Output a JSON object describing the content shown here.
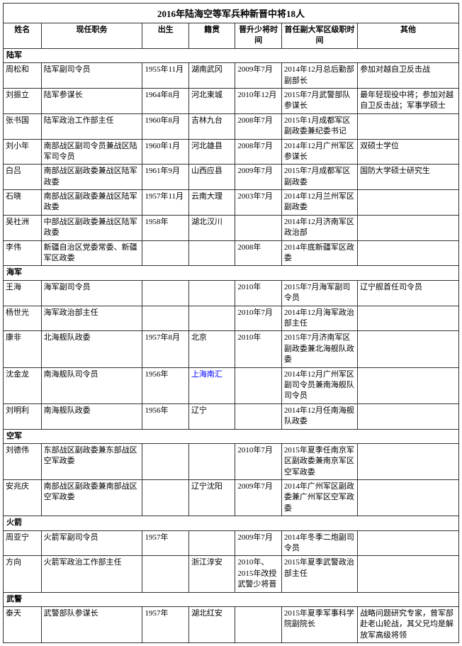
{
  "title": "2016年陆海空等军兵种新晋中将18人",
  "headers": [
    "姓名",
    "现任职务",
    "出生",
    "籍贯",
    "晋升少将时间",
    "首任副大军区级职时间",
    "其他"
  ],
  "sections": [
    {
      "section_name": "陆军",
      "rows": [
        {
          "name": "周松和",
          "job": "陆军副司令员",
          "birth": "1955年11月",
          "origin": "湖南武冈",
          "promote": "2009年7月",
          "vice": "2014年12月总后勤部副部长",
          "other": "参加对越自卫反击战"
        },
        {
          "name": "刘振立",
          "job": "陆军参谋长",
          "birth": "1964年8月",
          "origin": "河北束城",
          "promote": "2010年12月",
          "vice": "2015年7月武警部队参谋长",
          "other": "最年轻现役中将；参加对越自卫反击战；军事学硕士"
        },
        {
          "name": "张书国",
          "job": "陆军政治工作部主任",
          "birth": "1960年8月",
          "origin": "吉林九台",
          "promote": "2008年7月",
          "vice": "2015年1月成都军区副政委兼纪委书记",
          "other": ""
        },
        {
          "name": "刘小年",
          "job": "南部战区副司令员兼战区陆军司令员",
          "birth": "1960年1月",
          "origin": "河北雄县",
          "promote": "2008年7月",
          "vice": "2014年12月广州军区参谋长",
          "other": "双硕士学位"
        },
        {
          "name": "白吕",
          "job": "南部战区副政委兼战区陆军政委",
          "birth": "1961年9月",
          "origin": "山西应县",
          "promote": "2009年7月",
          "vice": "2015年7月成都军区副政委",
          "other": "国防大学硕士研究生"
        },
        {
          "name": "石晓",
          "job": "南部战区副政委兼战区陆军政委",
          "birth": "1957年11月",
          "origin": "云南大理",
          "promote": "2003年7月",
          "vice": "2014年12月兰州军区副政委",
          "other": ""
        },
        {
          "name": "吴社洲",
          "job": "中部战区副政委兼战区陆军政委",
          "birth": "1958年",
          "origin": "湖北汉川",
          "promote": "",
          "vice": "2014年12月济南军区政治部",
          "other": ""
        },
        {
          "name": "李伟",
          "job": "新疆自治区党委常委、新疆军区政委",
          "birth": "",
          "origin": "",
          "promote": "2008年",
          "vice": "2014年底新疆军区政委",
          "other": ""
        }
      ]
    },
    {
      "section_name": "海军",
      "rows": [
        {
          "name": "王海",
          "job": "海军副司令员",
          "birth": "",
          "origin": "",
          "promote": "2010年",
          "vice": "2015年7月海军副司令员",
          "other": "辽宁舰首任司令员"
        },
        {
          "name": "杨世光",
          "job": "海军政治部主任",
          "birth": "",
          "origin": "",
          "promote": "2010年7月",
          "vice": "2014年12月海军政治部主任",
          "other": ""
        },
        {
          "name": "康非",
          "job": "北海舰队政委",
          "birth": "1957年8月",
          "origin": "北京",
          "promote": "2010年",
          "vice": "2015年7月济南军区副政委兼北海舰队政委",
          "other": ""
        },
        {
          "name": "沈金龙",
          "job": "南海舰队司令员",
          "birth": "1956年",
          "origin": "上海南汇",
          "promote": "",
          "vice": "2014年12月广州军区副司令员兼南海舰队司令员",
          "other": ""
        },
        {
          "name": "刘明利",
          "job": "南海舰队政委",
          "birth": "1956年",
          "origin": "辽宁",
          "promote": "",
          "vice": "2014年12月任南海舰队政委",
          "other": ""
        }
      ]
    },
    {
      "section_name": "空军",
      "rows": [
        {
          "name": "刘德伟",
          "job": "东部战区副政委兼东部战区空军政委",
          "birth": "",
          "origin": "",
          "promote": "2010年7月",
          "vice": "2015年夏季任南京军区副政委兼南京军区空军政委",
          "other": ""
        },
        {
          "name": "安兆庆",
          "job": "南部战区副政委兼南部战区空军政委",
          "birth": "",
          "origin": "辽宁沈阳",
          "promote": "2009年7月",
          "vice": "2014年广州军区副政委兼广州军区空军政委",
          "other": ""
        }
      ]
    },
    {
      "section_name": "火箭",
      "rows": [
        {
          "name": "周亚宁",
          "job": "火箭军副司令员",
          "birth": "1957年",
          "origin": "",
          "promote": "2009年7月",
          "vice": "2014年冬季二炮副司令员",
          "other": ""
        },
        {
          "name": "方向",
          "job": "火箭军政治工作部主任",
          "birth": "",
          "origin": "浙江淳安",
          "promote": "2010年、2015年改授武警少将晋",
          "vice": "2015年夏季武警政治部主任",
          "other": ""
        }
      ]
    },
    {
      "section_name": "武警",
      "rows": [
        {
          "name": "泰天",
          "job": "武警部队参谋长",
          "birth": "1957年",
          "origin": "湖北红安",
          "promote": "",
          "vice": "2015年夏季军事科学院副院长",
          "other": "战略问题研究专家，曾军部赴老山轮战，其父兄均是解放军高级将领"
        }
      ]
    }
  ]
}
